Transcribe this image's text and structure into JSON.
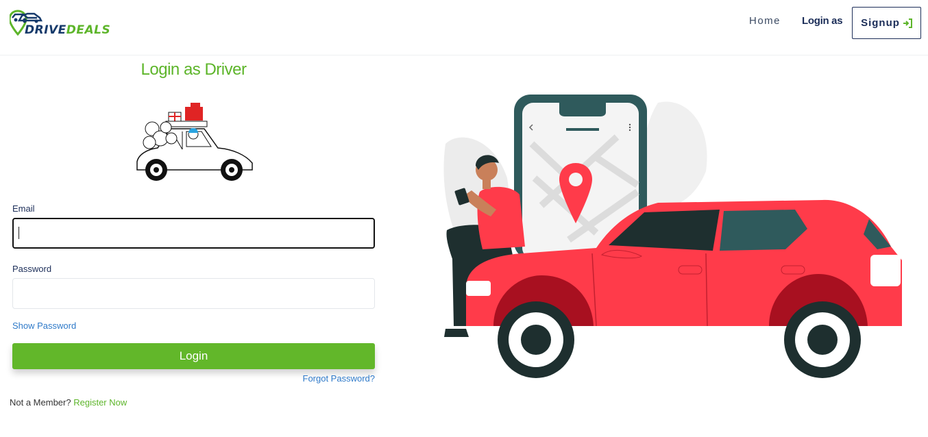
{
  "brand": {
    "name_part1": "DRIVE",
    "name_part2": "DEALS"
  },
  "nav": {
    "home": "Home",
    "login_as": "Login as",
    "signup": "Signup"
  },
  "icons": {
    "signup": "sign-in-arrow-icon",
    "logo": "location-pin-car-icon"
  },
  "colors": {
    "accent": "#5db52a",
    "primary": "#1b2d58",
    "link": "#2f7ac9",
    "car": "#ff3b4a"
  },
  "form": {
    "title": "Login as Driver",
    "email_label": "Email",
    "email_value": "",
    "password_label": "Password",
    "password_value": "",
    "show_password": "Show Password",
    "login_button": "Login",
    "forgot_password": "Forgot Password?",
    "not_member": "Not a Member?",
    "register_now": "Register Now"
  }
}
